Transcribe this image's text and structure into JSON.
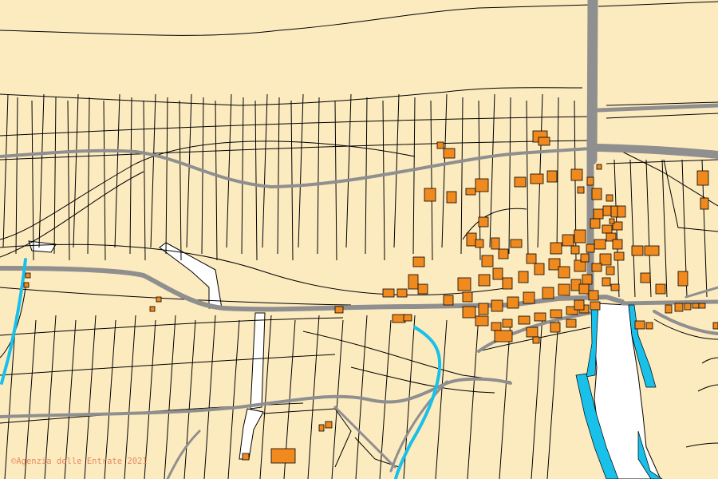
{
  "map": {
    "type": "cadastral parcel map",
    "attribution": "©Agenzia delle Entrate 2021",
    "colors": {
      "parcel_fill": "#fdebc0",
      "parcel_border": "#000000",
      "building": "#f08a1e",
      "road": "#8f8f8f",
      "water": "#19c0ea",
      "unmapped_area": "#ffffff",
      "attribution_text": "#e8895f"
    },
    "legend": {
      "parcels": "parcel",
      "buildings": "building",
      "roads": "road",
      "watercourses": "watercourse"
    }
  }
}
